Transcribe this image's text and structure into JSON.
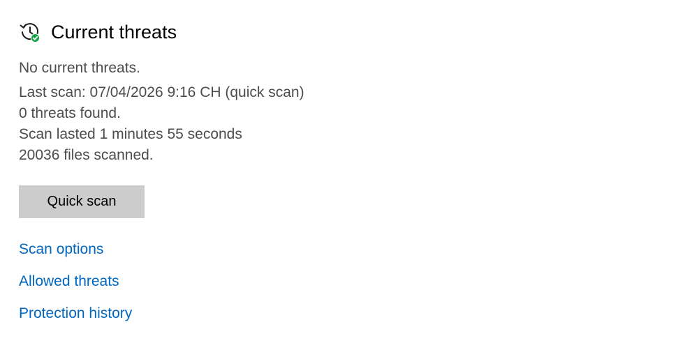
{
  "header": {
    "title": "Current threats",
    "icon": "history-shield-check-icon"
  },
  "status": {
    "text": "No current threats."
  },
  "details": {
    "last_scan": "Last scan: 07/04/2026 9:16 CH (quick scan)",
    "threats_found": "0 threats found.",
    "duration": "Scan lasted 1 minutes 55 seconds",
    "files_scanned": "20036 files scanned."
  },
  "actions": {
    "quick_scan_label": "Quick scan"
  },
  "links": {
    "scan_options": "Scan options",
    "allowed_threats": "Allowed threats",
    "protection_history": "Protection history"
  },
  "colors": {
    "link": "#0067c0",
    "button_bg": "#cccccc",
    "check_badge": "#16a34a",
    "text_secondary": "#4c4c4c"
  }
}
